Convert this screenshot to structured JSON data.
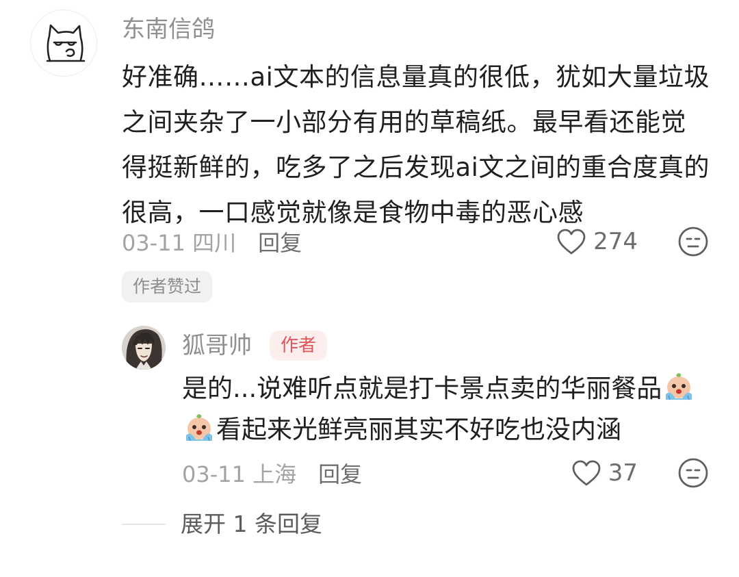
{
  "comment": {
    "username": "东南信鸽",
    "text": "好准确……ai文本的信息量真的很低，犹如大量垃圾之间夹杂了一小部分有用的草稿纸。最早看还能觉得挺新鲜的，吃多了之后发现ai文之间的重合度真的很高，一口感觉就像是食物中毒的恶心感",
    "date_location": "03-11 四川",
    "reply_label": "回复",
    "like_count": "274",
    "author_liked_label": "作者赞过",
    "avatar_icon": "cat-doodle-avatar",
    "like_icon": "heart-outline-icon",
    "emoji_icon": "neutral-face-icon"
  },
  "reply": {
    "username": "狐哥帅",
    "author_badge": "作者",
    "text_part1": "是的...说难听点就是打卡景点卖的华丽餐品",
    "text_part2": "看起来光鲜亮丽其实不好吃也没内涵",
    "inline_emoji": "crying-sticker-emoji",
    "date_location": "03-11 上海",
    "reply_label": "回复",
    "like_count": "37",
    "avatar_icon": "anime-character-avatar"
  },
  "expand": {
    "label": "展开 1 条回复"
  },
  "colors": {
    "author_badge_bg": "#fdeeee",
    "author_badge_text": "#e2545b",
    "muted_text": "#8f8f8f",
    "body_text": "#1f1f1f",
    "liked_badge_bg": "#f1f1f1"
  }
}
